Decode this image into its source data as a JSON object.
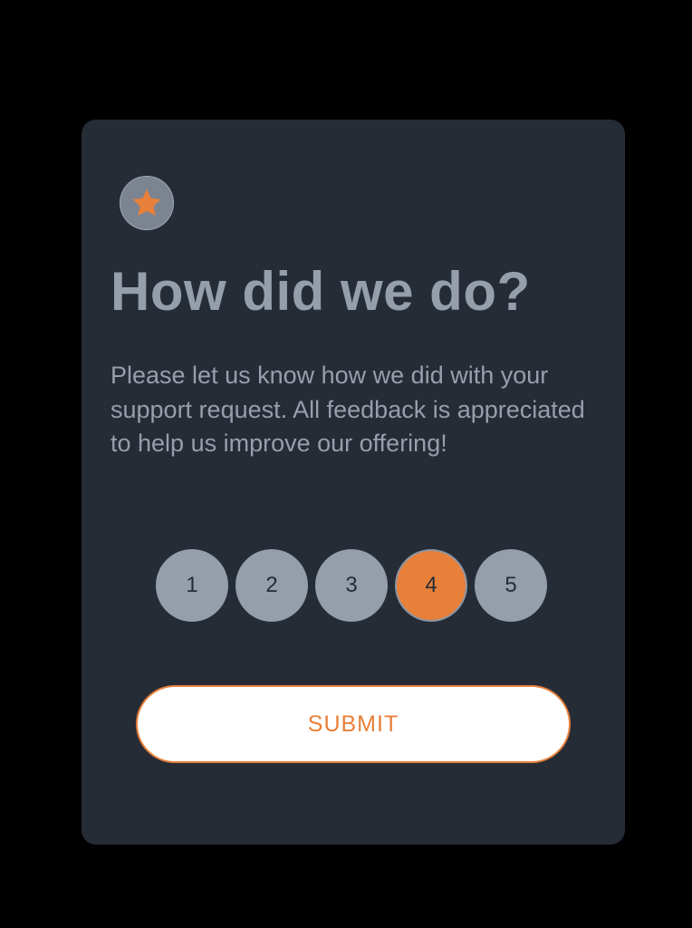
{
  "card": {
    "icon": "star-icon",
    "title": "How did we do?",
    "description": "Please let us know how we did with your support request. All feedback is appreciated to help us improve our offering!",
    "ratings": [
      "1",
      "2",
      "3",
      "4",
      "5"
    ],
    "selected_rating": "4",
    "submit_label": "SUBMIT"
  },
  "colors": {
    "page_background": "#000000",
    "card_background": "#262c36",
    "accent": "#e8803a",
    "muted_text": "#959eab",
    "rating_background": "#959eab"
  }
}
